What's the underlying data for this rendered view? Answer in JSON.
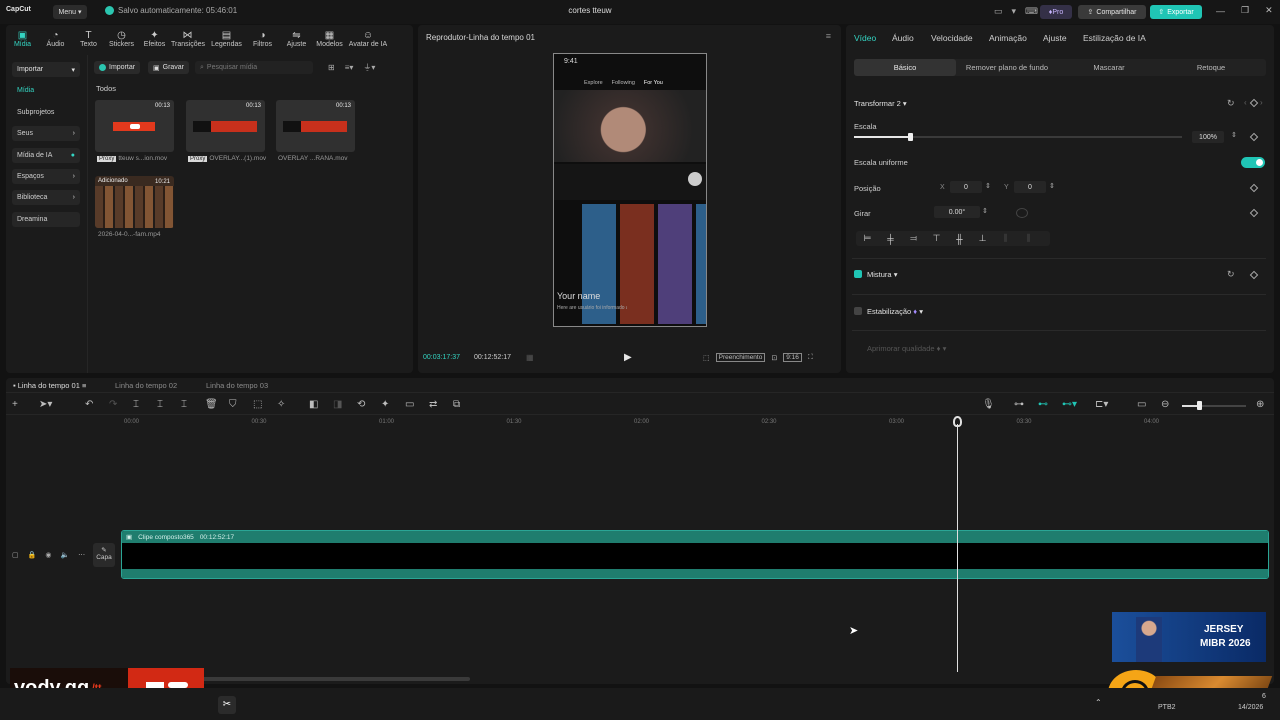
{
  "titlebar": {
    "logo": "CapCut",
    "menu_label": "Menu",
    "autosave": "Salvo automaticamente: 05:46:01",
    "project_title": "cortes tteuw",
    "pro_label": "Pro",
    "share_label": "Compartilhar",
    "export_label": "Exportar"
  },
  "media": {
    "tabs": [
      {
        "label": "Mídia",
        "icon": "media-icon"
      },
      {
        "label": "Áudio",
        "icon": "audio-icon"
      },
      {
        "label": "Texto",
        "icon": "text-icon"
      },
      {
        "label": "Stickers",
        "icon": "sticker-icon"
      },
      {
        "label": "Efeitos",
        "icon": "effects-icon"
      },
      {
        "label": "Transições",
        "icon": "transition-icon"
      },
      {
        "label": "Legendas",
        "icon": "captions-icon"
      },
      {
        "label": "Filtros",
        "icon": "filter-icon"
      },
      {
        "label": "Ajuste",
        "icon": "adjust-icon"
      },
      {
        "label": "Modelos",
        "icon": "templates-icon"
      },
      {
        "label": "Avatar de IA",
        "icon": "avatar-icon"
      }
    ],
    "sidebar": [
      "Importar",
      "Mídia",
      "Subprojetos",
      "Seus",
      "Mídia de IA",
      "Espaços",
      "Biblioteca",
      "Dreamina"
    ],
    "import_label": "Importar",
    "record_label": "Gravar",
    "search_placeholder": "Pesquisar mídia",
    "section_label": "Todos",
    "items": [
      {
        "name": "tteuw s...ion.mov",
        "duration": "00:13",
        "proxy": "Proxy"
      },
      {
        "name": "OVERLAY...(1).mov",
        "duration": "00:13",
        "proxy": "Proxy"
      },
      {
        "name": "OVERLAY ...RANA.mov",
        "duration": "00:13",
        "proxy": ""
      },
      {
        "name": "2026-04-0...-fam.mp4",
        "duration": "10:21",
        "badge": "Adicionado"
      }
    ]
  },
  "player": {
    "title": "Reprodutor-Linha do tempo 01",
    "current_time": "00:03:17:37",
    "total_time": "00:12:52:17",
    "fill_label": "Preenchimento",
    "ratio": "9:16",
    "phone_time": "9:41",
    "phone_tabs": [
      "Explore",
      "Following",
      "For You"
    ],
    "phone_text_name": "Your name",
    "phone_text_sub": "Here are usuário foi informado about videos"
  },
  "props": {
    "tabs": [
      "Vídeo",
      "Áudio",
      "Velocidade",
      "Animação",
      "Ajuste",
      "Estilização de IA"
    ],
    "subtabs": [
      "Básico",
      "Remover plano de fundo",
      "Mascarar",
      "Retoque"
    ],
    "transform_label": "Transformar 2",
    "scale_label": "Escala",
    "scale_value": "100%",
    "scale_fraction": 0.05,
    "uniform_label": "Escala uniforme",
    "position_label": "Posição",
    "x_label": "X",
    "x_value": "0",
    "y_label": "Y",
    "y_value": "0",
    "rotate_label": "Girar",
    "rotate_value": "0.00°",
    "blend_label": "Mistura",
    "stabilize_label": "Estabilização",
    "enhance_label": "Aprimorar qualidade"
  },
  "timeline": {
    "tabs": [
      "Linha do tempo 01",
      "Linha do tempo 02",
      "Linha do tempo 03"
    ],
    "ticks": [
      "00:00",
      "00:30",
      "01:00",
      "01:30",
      "02:00",
      "02:30",
      "03:00",
      "03:30",
      "04:00"
    ],
    "clip_label": "Clipe composto365",
    "clip_duration": "00:12:52:17",
    "cover_label": "Capa"
  },
  "overlays": {
    "vody_brand": "vody.gg",
    "vody_handle": "/tt",
    "ad_title": "JERSEY",
    "ad_subtitle": "MIBR 2026"
  },
  "taskbar": {
    "lang": "PTB2",
    "date": "14/2026",
    "time": "6"
  },
  "colors": {
    "accent": "#20c5b5",
    "clip": "#1f7d6e",
    "playhead": "#e0e0e0"
  }
}
